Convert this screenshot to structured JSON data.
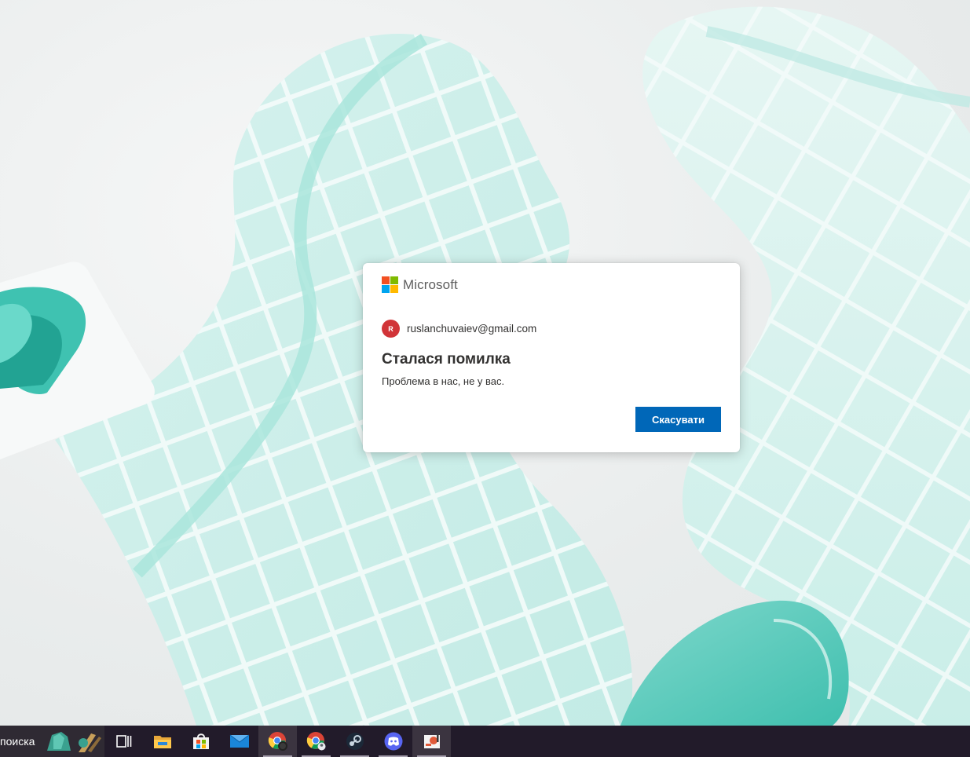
{
  "dialog": {
    "brand": "Microsoft",
    "logo_colors": [
      "#f25022",
      "#7fba00",
      "#00a4ef",
      "#ffb900"
    ],
    "avatar_initial": "R",
    "avatar_color": "#d13438",
    "account_email": "ruslanchuvaiev@gmail.com",
    "title": "Сталася помилка",
    "description": "Проблема в нас, не у вас.",
    "cancel_label": "Скасувати",
    "accent_color": "#0067b8"
  },
  "taskbar": {
    "search_text": "поиска",
    "items": [
      {
        "icon": "task-view-icon",
        "running": false
      },
      {
        "icon": "file-explorer-icon",
        "running": false
      },
      {
        "icon": "microsoft-store-icon",
        "running": false
      },
      {
        "icon": "mail-icon",
        "running": false
      },
      {
        "icon": "chrome-profile-icon",
        "running": true,
        "active": true
      },
      {
        "icon": "chrome-icon",
        "running": true
      },
      {
        "icon": "steam-icon",
        "running": true
      },
      {
        "icon": "discord-icon",
        "running": true
      },
      {
        "icon": "paint-app-icon",
        "running": true,
        "active": true
      }
    ],
    "background_color": "#221b2a"
  }
}
